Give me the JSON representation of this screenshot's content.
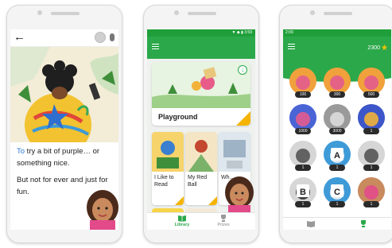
{
  "reader": {
    "story_highlight": "To",
    "story_line1_rest": " try a bit of purple… or something nice.",
    "story_line2": "But not for ever and just for fun."
  },
  "library": {
    "featured_title": "Playground",
    "books": [
      {
        "title": "I Like to Read"
      },
      {
        "title": "My Red Ball"
      },
      {
        "title": "Wh..."
      }
    ],
    "nav": {
      "library": "Library",
      "prizes": "Prizes"
    }
  },
  "prizes": {
    "status_time": "2:09",
    "points": "2300",
    "items": [
      {
        "cost": "100"
      },
      {
        "cost": "300"
      },
      {
        "cost": "500"
      },
      {
        "cost": "1000"
      },
      {
        "cost": "3000"
      },
      {
        "cost": "1"
      },
      {
        "cost": "1"
      },
      {
        "cost": "1"
      },
      {
        "cost": "1"
      },
      {
        "cost": "1"
      },
      {
        "cost": "1"
      },
      {
        "cost": "1"
      }
    ]
  },
  "colors": {
    "brand_green": "#2ba84a",
    "dark_green": "#1f9f3a",
    "accent_yellow": "#f5b400",
    "highlight_blue": "#2f78d4"
  }
}
